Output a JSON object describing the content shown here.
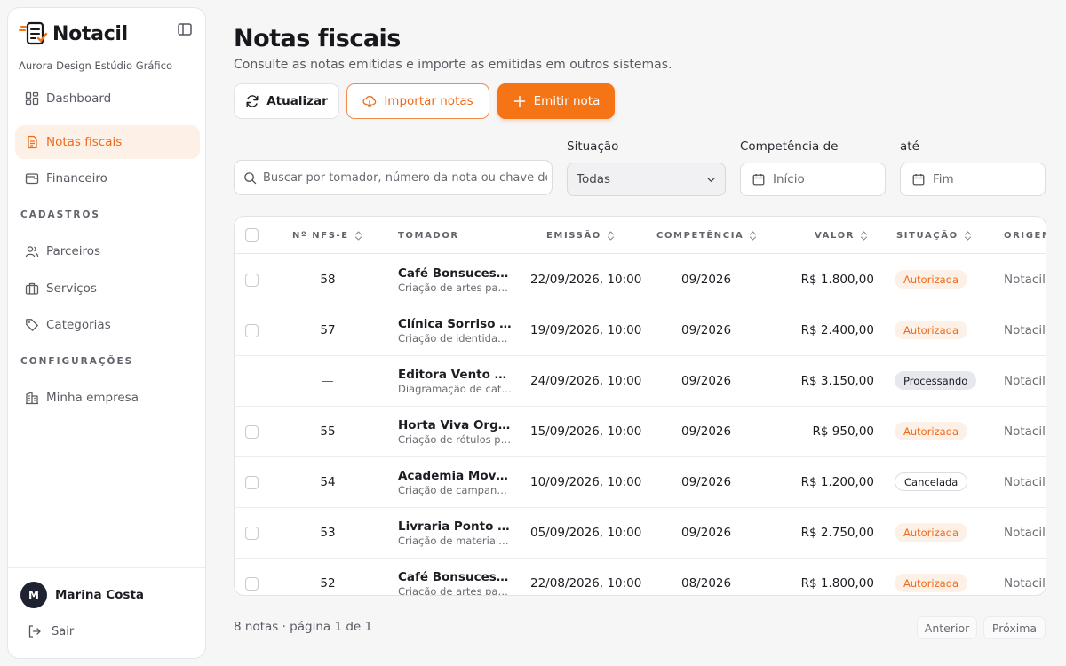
{
  "app": {
    "name": "Notacil",
    "company": "Aurora Design Estúdio Gráfico"
  },
  "sidebar": {
    "items": [
      {
        "label": "Dashboard",
        "icon": "dashboard-icon",
        "active": false
      },
      {
        "label": "Notas fiscais",
        "icon": "document-icon",
        "active": true
      },
      {
        "label": "Financeiro",
        "icon": "wallet-icon",
        "active": false
      }
    ],
    "sections": [
      {
        "title": "CADASTROS",
        "items": [
          {
            "label": "Parceiros",
            "icon": "users-icon"
          },
          {
            "label": "Serviços",
            "icon": "briefcase-icon"
          },
          {
            "label": "Categorias",
            "icon": "tag-icon"
          }
        ]
      },
      {
        "title": "CONFIGURAÇÕES",
        "items": [
          {
            "label": "Minha empresa",
            "icon": "building-icon"
          }
        ]
      }
    ],
    "user": {
      "initial": "M",
      "name": "Marina Costa"
    },
    "logout_label": "Sair"
  },
  "header": {
    "title": "Notas fiscais",
    "subtitle": "Consulte as notas emitidas e importe as emitidas em outros sistemas."
  },
  "actions": {
    "refresh_label": "Atualizar",
    "import_label": "Importar notas",
    "emit_label": "Emitir nota"
  },
  "filters": {
    "search_placeholder": "Buscar por tomador, número da nota ou chave de acesso",
    "situacao_label": "Situação",
    "situacao_value": "Todas",
    "competencia_label": "Competência de",
    "competencia_placeholder": "Início",
    "ate_label": "até",
    "ate_placeholder": "Fim"
  },
  "table": {
    "columns": [
      "Nº NFS-E",
      "TOMADOR",
      "EMISSÃO",
      "COMPETÊNCIA",
      "VALOR",
      "SITUAÇÃO",
      "ORIGEM"
    ],
    "rows": [
      {
        "num": "58",
        "tomador": "Café Bonsucesso Ltda",
        "descricao": "Criação de artes para cardápio",
        "emissao": "22/09/2026, 10:00",
        "competencia": "09/2026",
        "valor": "R$ 1.800,00",
        "situacao": "Autorizada",
        "origem": "Notacil"
      },
      {
        "num": "57",
        "tomador": "Clínica Sorriso Pleno",
        "descricao": "Criação de identidade visual",
        "emissao": "19/09/2026, 10:00",
        "competencia": "09/2026",
        "valor": "R$ 2.400,00",
        "situacao": "Autorizada",
        "origem": "Notacil"
      },
      {
        "num": "—",
        "tomador": "Editora Vento Norte",
        "descricao": "Diagramação de catálogo",
        "emissao": "24/09/2026, 10:00",
        "competencia": "09/2026",
        "valor": "R$ 3.150,00",
        "situacao": "Processando",
        "origem": "Notacil"
      },
      {
        "num": "55",
        "tomador": "Horta Viva Orgânicos",
        "descricao": "Criação de rótulos para produtos",
        "emissao": "15/09/2026, 10:00",
        "competencia": "09/2026",
        "valor": "R$ 950,00",
        "situacao": "Autorizada",
        "origem": "Notacil"
      },
      {
        "num": "54",
        "tomador": "Academia Movimento",
        "descricao": "Criação de campanha digital",
        "emissao": "10/09/2026, 10:00",
        "competencia": "09/2026",
        "valor": "R$ 1.200,00",
        "situacao": "Cancelada",
        "origem": "Notacil"
      },
      {
        "num": "53",
        "tomador": "Livraria Ponto Final",
        "descricao": "Criação de material gráfico",
        "emissao": "05/09/2026, 10:00",
        "competencia": "09/2026",
        "valor": "R$ 2.750,00",
        "situacao": "Autorizada",
        "origem": "Notacil"
      },
      {
        "num": "52",
        "tomador": "Café Bonsucesso Ltda",
        "descricao": "Criação de artes para cardápio",
        "emissao": "22/08/2026, 10:00",
        "competencia": "08/2026",
        "valor": "R$ 1.800,00",
        "situacao": "Autorizada",
        "origem": "Notacil"
      }
    ]
  },
  "pagination": {
    "summary": "8 notas · página 1 de 1",
    "prev_label": "Anterior",
    "next_label": "Próxima"
  },
  "colors": {
    "accent": "#f57416",
    "accent_soft": "#fdf0e7",
    "text": "#1c1c22"
  }
}
